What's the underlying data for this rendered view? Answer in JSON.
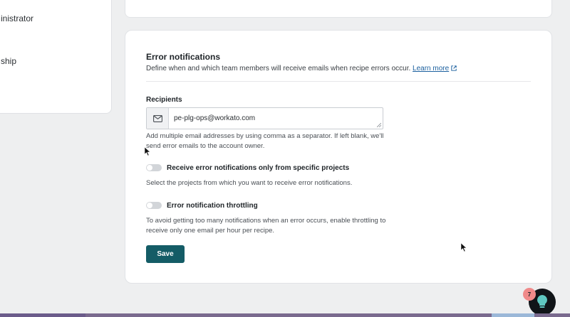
{
  "sidebar": {
    "items": [
      {
        "label": "inistrator"
      },
      {
        "label": "ship"
      }
    ]
  },
  "error_notifications": {
    "title": "Error notifications",
    "description": "Define when and which team members will receive emails when recipe errors occur.",
    "learn_more": "Learn more",
    "recipients_label": "Recipients",
    "recipients_value": "pe-plg-ops@workato.com",
    "recipients_help": "Add multiple email addresses by using comma as a separator. If left blank, we'll send error emails to the account owner.",
    "projects_toggle": {
      "label": "Receive error notifications only from specific projects",
      "help": "Select the projects from which you want to receive error notifications.",
      "on": false
    },
    "throttling_toggle": {
      "label": "Error notification throttling",
      "help": "To avoid getting too many notifications when an error occurs, enable throttling to receive only one email per hour per recipe.",
      "on": false
    },
    "save_label": "Save"
  },
  "help_widget": {
    "badge_count": "7",
    "icon": "lightbulb-icon"
  },
  "colors": {
    "accent": "#145c66",
    "link": "#1a5f9e",
    "badge": "#f08a8a"
  }
}
